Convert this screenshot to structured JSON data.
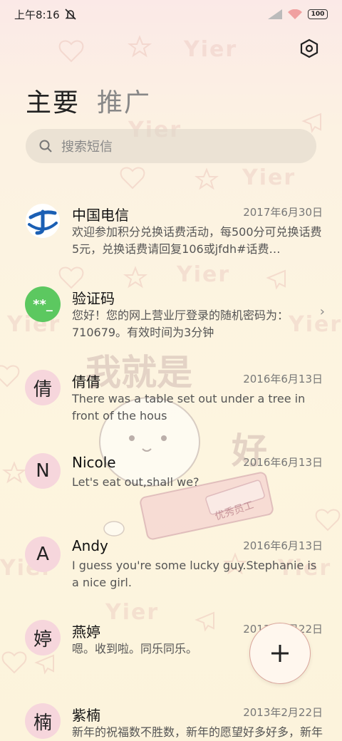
{
  "status_bar": {
    "time": "上午8:16",
    "battery": "100"
  },
  "tabs": [
    {
      "label": "主要"
    },
    {
      "label": "推广"
    }
  ],
  "search": {
    "placeholder": "搜索短信"
  },
  "messages": [
    {
      "name": "中国电信",
      "date": "2017年6月30日",
      "preview": "欢迎参加积分兑换话费活动，每500分可兑换话费5元，兑换话费请回复106或jfdh#话费…",
      "avatar": "telecom-logo-icon"
    },
    {
      "name": "验证码",
      "date": "",
      "preview": "您好！您的网上营业厅登录的随机密码为：710679。有效时间为3分钟",
      "avatar": "**_"
    },
    {
      "name": "倩倩",
      "date": "2016年6月13日",
      "preview": "There was a table set out under a tree in front of the hous",
      "avatar": "倩"
    },
    {
      "name": "Nicole",
      "date": "2016年6月13日",
      "preview": "Let's eat out,shall we?",
      "avatar": "N"
    },
    {
      "name": "Andy",
      "date": "2016年6月13日",
      "preview": "I guess you're some lucky guy.Stephanie is a nice girl.",
      "avatar": "A"
    },
    {
      "name": "燕婷",
      "date": "2013年2月22日",
      "preview": "嗯。收到啦。同乐同乐。",
      "avatar": "婷"
    },
    {
      "name": "紫楠",
      "date": "2013年2月22日",
      "preview": "新年的祝福数不胜数，新年的愿望好多好多，新年的问候依旧美好，在这个温馨的时刻，…",
      "avatar": "楠"
    }
  ],
  "theme": {
    "watermark_text": "Yier",
    "sticker_text_top": "我就是",
    "sticker_text_side": "好",
    "sticker_badge": "优秀员工"
  },
  "colors": {
    "avatar_pink": "#f6d6dc",
    "avatar_green": "#5cc860",
    "telecom_blue": "#1a5fb4"
  }
}
